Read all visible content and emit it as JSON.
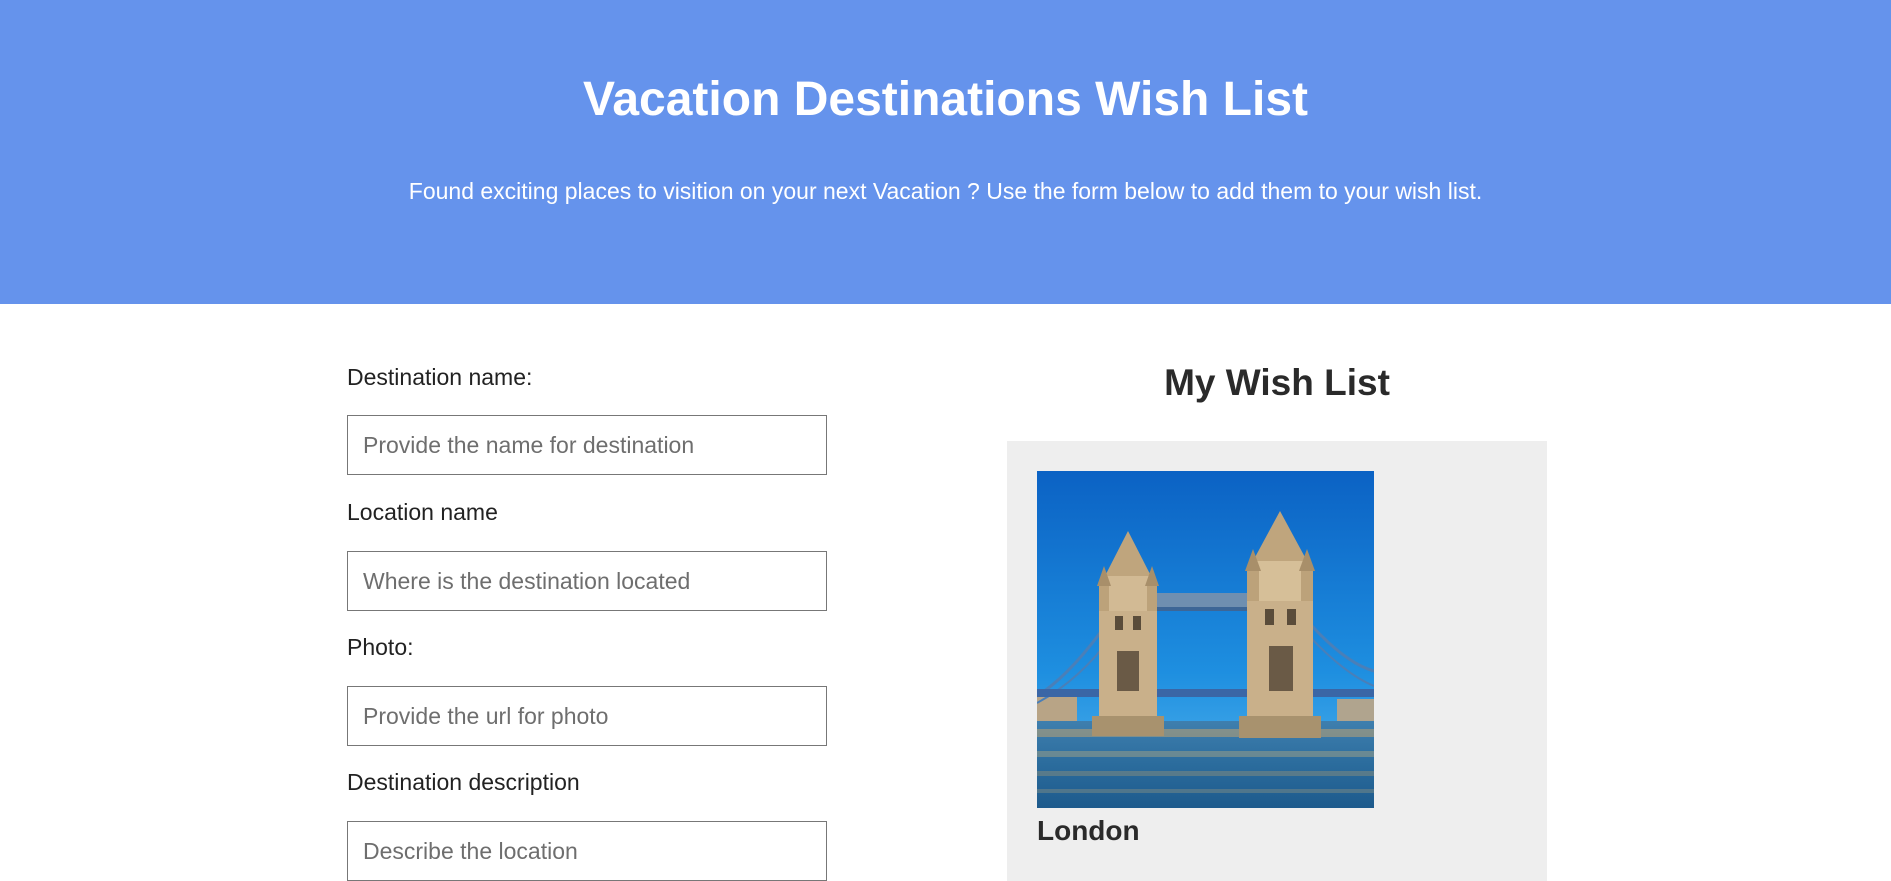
{
  "header": {
    "title": "Vacation Destinations Wish List",
    "subtitle": "Found exciting places to visition on your next Vacation ? Use the form below to add them to your wish list."
  },
  "form": {
    "destination": {
      "label": "Destination name:",
      "placeholder": "Provide the name for destination"
    },
    "location": {
      "label": "Location name",
      "placeholder": "Where is the destination located"
    },
    "photo": {
      "label": "Photo:",
      "placeholder": "Provide the url for photo"
    },
    "description": {
      "label": "Destination description",
      "placeholder": "Describe the location"
    }
  },
  "wishlist": {
    "title": "My Wish List",
    "cards": [
      {
        "name": "London"
      }
    ]
  },
  "colors": {
    "header_bg": "#6593ec",
    "card_bg": "#eeeeee"
  }
}
